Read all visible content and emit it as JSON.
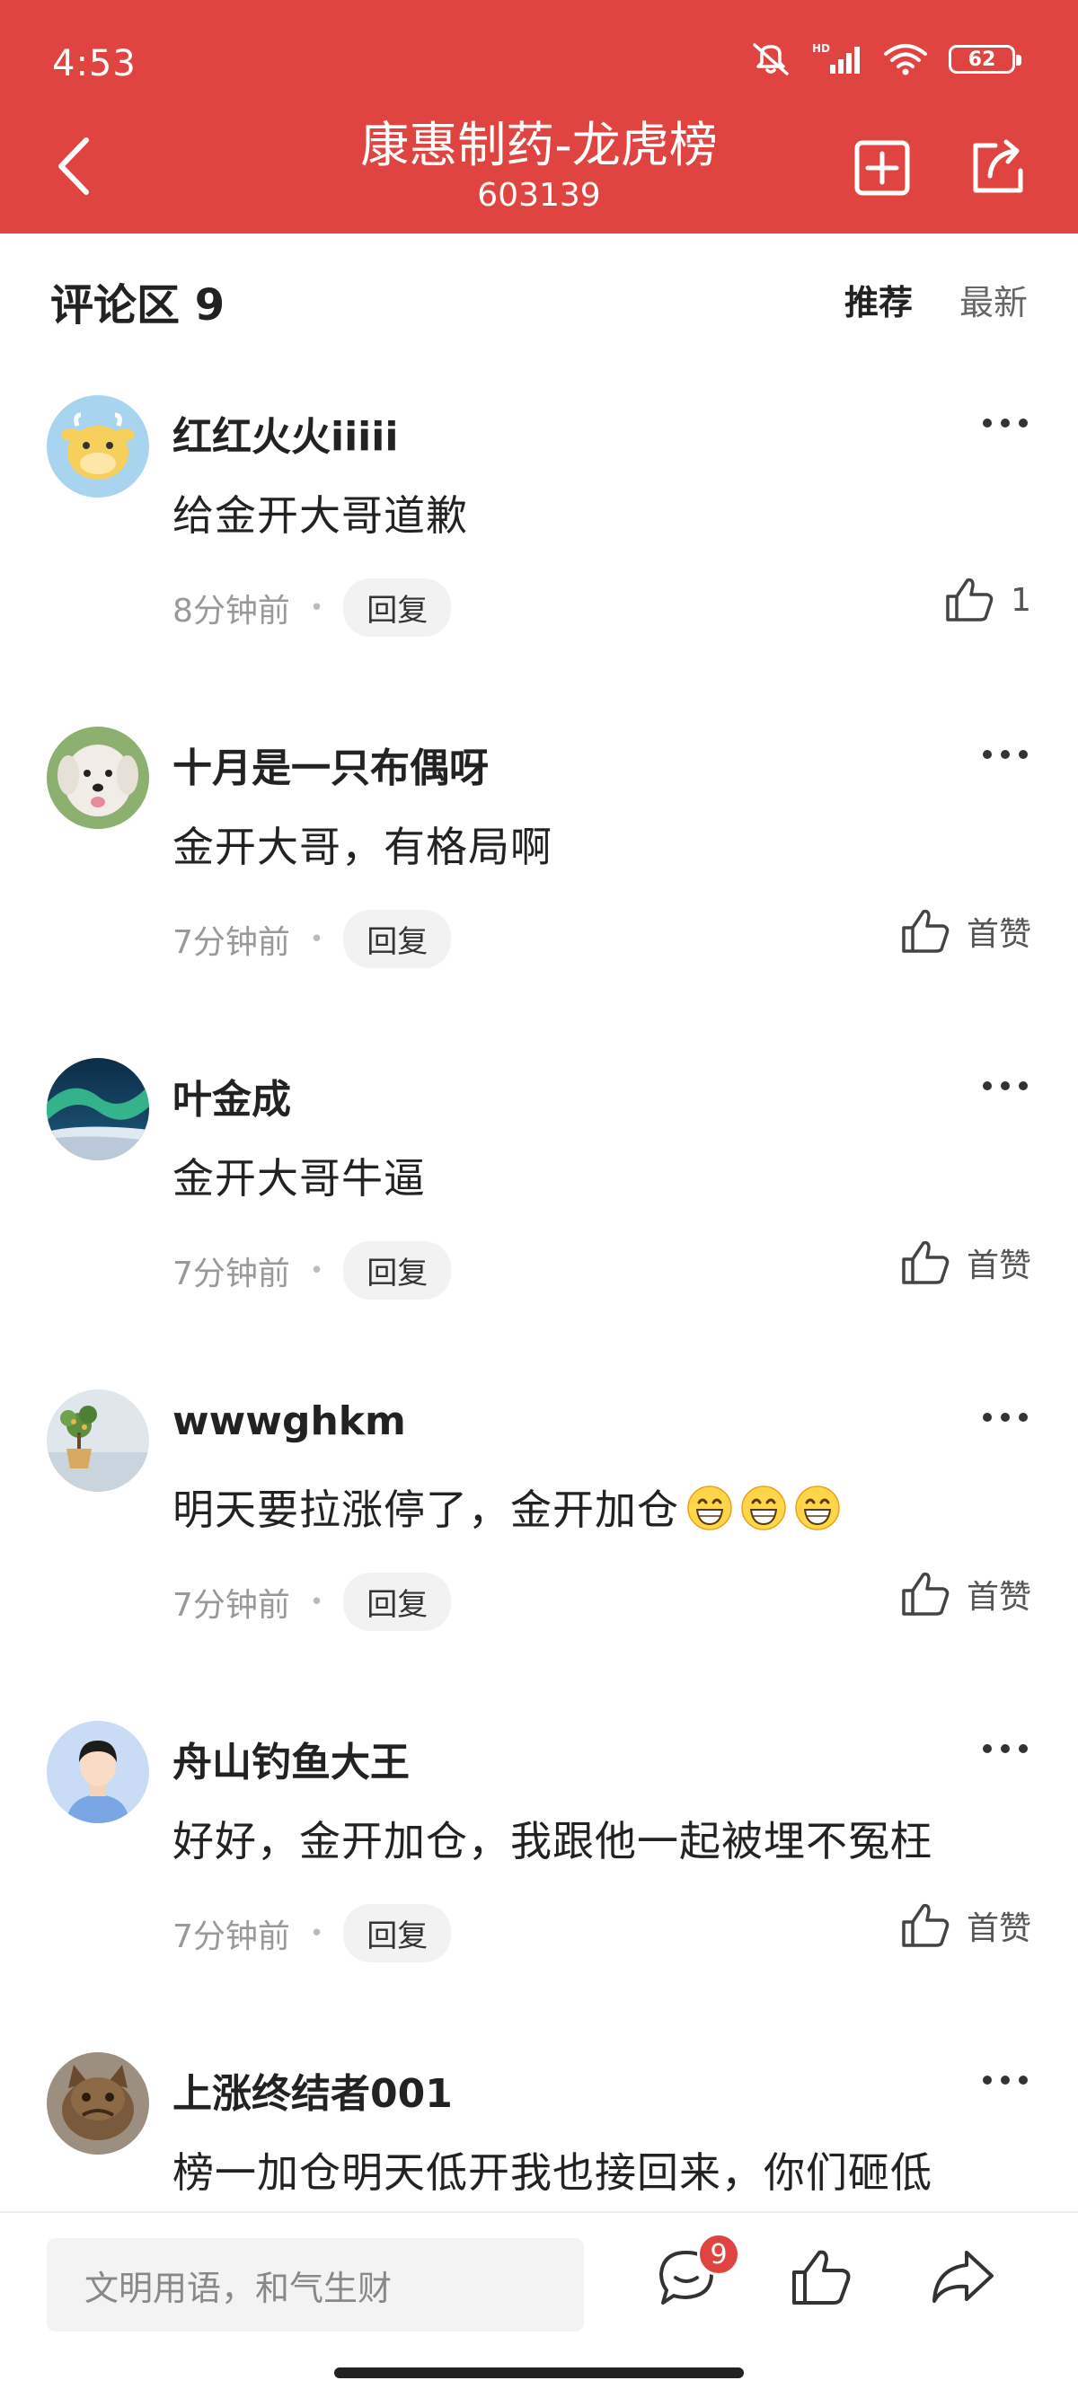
{
  "status_bar": {
    "time": "4:53",
    "battery": "62",
    "network": "HD"
  },
  "header": {
    "title": "康惠制药-龙虎榜",
    "subtitle": "603139"
  },
  "comments_section": {
    "title": "评论区 9",
    "sort_tabs": [
      {
        "label": "推荐",
        "active": true
      },
      {
        "label": "最新",
        "active": false
      }
    ]
  },
  "comments": [
    {
      "username": "红红火火iiiii",
      "content": "给金开大哥道歉",
      "time": "8分钟前",
      "reply_label": "回复",
      "like_label": "1",
      "avatar": "cow-avatar"
    },
    {
      "username": "十月是一只布偶呀",
      "content": "金开大哥，有格局啊",
      "time": "7分钟前",
      "reply_label": "回复",
      "like_label": "首赞",
      "avatar": "dog-avatar"
    },
    {
      "username": "叶金成",
      "content": "金开大哥牛逼",
      "time": "7分钟前",
      "reply_label": "回复",
      "like_label": "首赞",
      "avatar": "aurora-avatar"
    },
    {
      "username": "wwwghkm",
      "content": "明天要拉涨停了，金开加仓",
      "time": "7分钟前",
      "reply_label": "回复",
      "like_label": "首赞",
      "avatar": "plant-avatar",
      "emoji_count": 3
    },
    {
      "username": "舟山钓鱼大王",
      "content": "好好，金开加仓，我跟他一起被埋不冤枉",
      "time": "7分钟前",
      "reply_label": "回复",
      "like_label": "首赞",
      "avatar": "man-avatar"
    },
    {
      "username": "上涨终结者001",
      "content": "榜一加仓明天低开我也接回来，你们砸低",
      "avatar": "cat-avatar"
    }
  ],
  "bottom_bar": {
    "input_placeholder": "文明用语，和气生财",
    "comment_count": "9"
  },
  "colors": {
    "brand_red": "#e04440"
  }
}
